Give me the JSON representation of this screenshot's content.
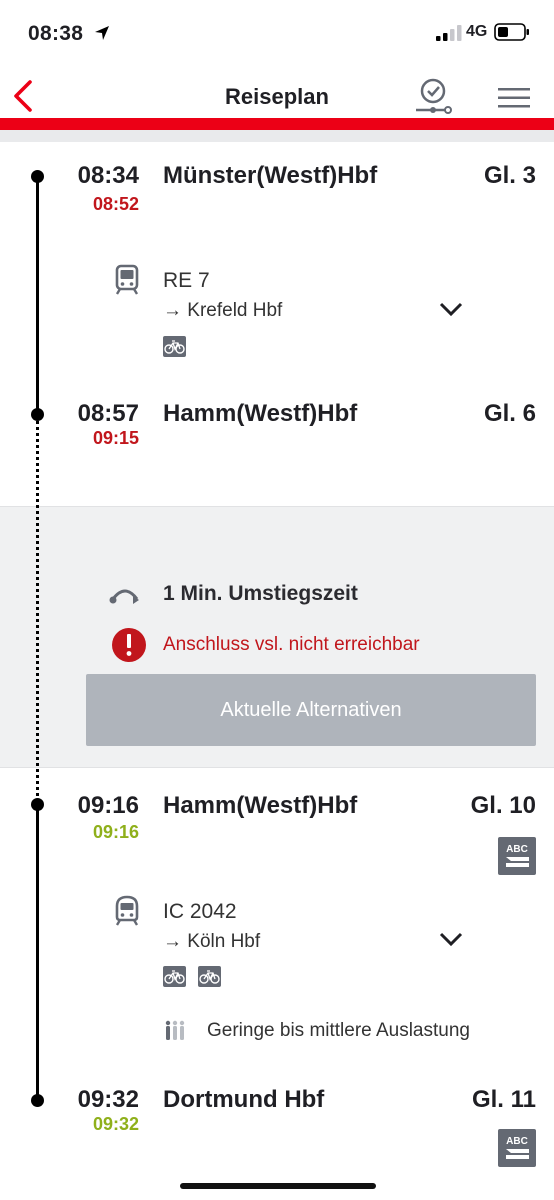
{
  "status_bar": {
    "time": "08:38",
    "network": "4G"
  },
  "nav": {
    "title": "Reiseplan"
  },
  "legs": [
    {
      "departure": {
        "time": "08:34",
        "realtime": "08:52",
        "station": "Münster(Westf)Hbf",
        "track": "Gl. 3"
      },
      "train": {
        "name": "RE 7",
        "direction": "→ Krefeld Hbf"
      },
      "arrival": {
        "time": "08:57",
        "realtime": "09:15",
        "station": "Hamm(Westf)Hbf",
        "track": "Gl. 6"
      }
    },
    {
      "departure": {
        "time": "09:16",
        "realtime": "09:16",
        "station": "Hamm(Westf)Hbf",
        "track": "Gl. 10"
      },
      "train": {
        "name": "IC 2042",
        "direction": "→ Köln Hbf"
      },
      "occupancy": "Geringe bis mittlere Auslastung",
      "arrival": {
        "time": "09:32",
        "realtime": "09:32",
        "station": "Dortmund Hbf",
        "track": "Gl. 11"
      }
    }
  ],
  "transfer": {
    "time_text": "1 Min. Umstiegszeit",
    "warning": "Anschluss vsl. nicht erreichbar",
    "button_label": "Aktuelle Alternativen"
  },
  "badges": {
    "abc_label": "ABC"
  },
  "colors": {
    "db_red": "#ec0016",
    "late": "#c1161c",
    "on_time": "#8fb01b",
    "button_grey": "#afb4bb"
  }
}
